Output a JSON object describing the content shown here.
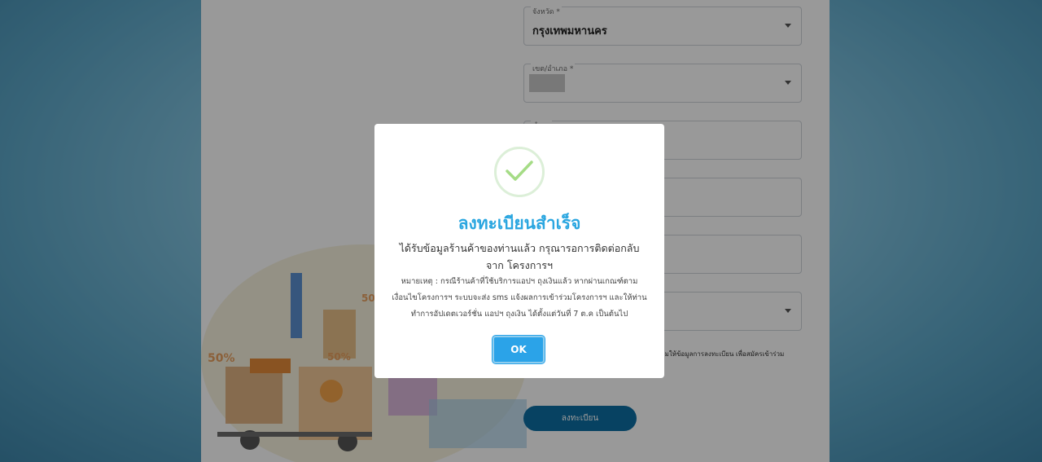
{
  "form": {
    "province": {
      "label": "จังหวัด *",
      "value": "กรุงเทพมหานคร"
    },
    "district": {
      "label": "เขต/อำเภอ *",
      "value": ""
    },
    "subdistrict": {
      "label": "ตำบล"
    },
    "consent_text": "ยอมให้ข้อมูลการลงทะเบียน เพื่อสมัครเข้าร่วม",
    "register_label": "ลงทะเบียน"
  },
  "illustration": {
    "badge_left": "50%",
    "badge_mid": "50%",
    "badge_top": "50%"
  },
  "modal": {
    "icon": "check-icon",
    "title": "ลงทะเบียนสำเร็จ",
    "body": "ได้รับข้อมูลร้านค้าของท่านแล้ว กรุณารอการติดต่อกลับจาก โครงการฯ",
    "note_line1": "หมายเหตุ : กรณีร้านค้าที่ใช้บริการแอปฯ ถุงเงินแล้ว หากผ่านเกณฑ์ตาม",
    "note_line2": "เงื่อนไขโครงการฯ ระบบจะส่ง sms แจ้งผลการเข้าร่วมโครงการฯ และให้ท่าน",
    "note_line3": "ทำการอัปเดตเวอร์ชั่น แอปฯ ถุงเงิน ได้ตั้งแต่วันที่ 7 ต.ค เป็นต้นไป",
    "ok_label": "OK"
  },
  "colors": {
    "accent": "#2aa6e0",
    "button": "#2ba3e8",
    "register": "#0d6ea3"
  }
}
